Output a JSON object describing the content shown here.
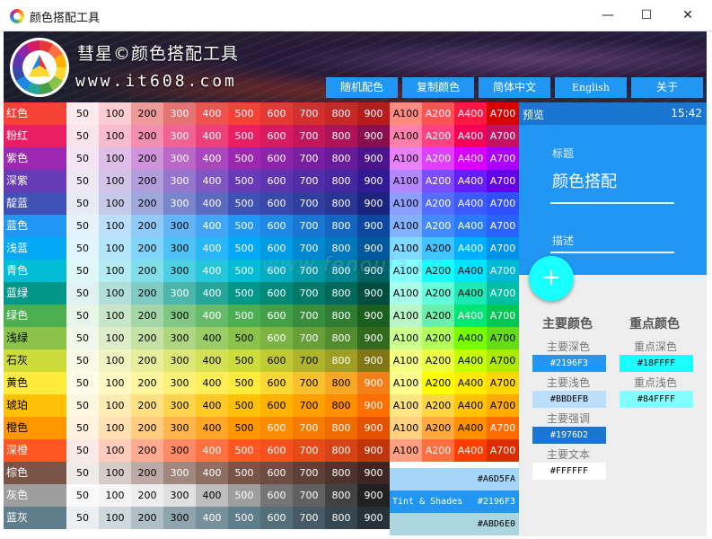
{
  "window": {
    "title": "颜色搭配工具"
  },
  "banner": {
    "brand": "彗星©颜色搭配工具",
    "site": "www.it608.com",
    "buttons": [
      "随机配色",
      "复制颜色",
      "简体中文",
      "English",
      "关于"
    ]
  },
  "grid": {
    "shade_labels": [
      "50",
      "100",
      "200",
      "300",
      "400",
      "500",
      "600",
      "700",
      "800",
      "900"
    ],
    "accent_labels": [
      "A100",
      "A200",
      "A400",
      "A700"
    ],
    "rows": [
      {
        "name": "红色",
        "shades": [
          "#ffebee",
          "#ffcdd2",
          "#ef9a9a",
          "#e57373",
          "#ef5350",
          "#f44336",
          "#e53935",
          "#d32f2f",
          "#c62828",
          "#b71c1c"
        ],
        "accents": [
          "#ff8a80",
          "#ff5252",
          "#ff1744",
          "#d50000"
        ]
      },
      {
        "name": "粉红",
        "shades": [
          "#fce4ec",
          "#f8bbd0",
          "#f48fb1",
          "#f06292",
          "#ec407a",
          "#e91e63",
          "#d81b60",
          "#c2185b",
          "#ad1457",
          "#880e4f"
        ],
        "accents": [
          "#ff80ab",
          "#ff4081",
          "#f50057",
          "#c51162"
        ]
      },
      {
        "name": "紫色",
        "shades": [
          "#f3e5f5",
          "#e1bee7",
          "#ce93d8",
          "#ba68c8",
          "#ab47bc",
          "#9c27b0",
          "#8e24aa",
          "#7b1fa2",
          "#6a1b9a",
          "#4a148c"
        ],
        "accents": [
          "#ea80fc",
          "#e040fb",
          "#d500f9",
          "#aa00ff"
        ]
      },
      {
        "name": "深紫",
        "shades": [
          "#ede7f6",
          "#d1c4e9",
          "#b39ddb",
          "#9575cd",
          "#7e57c2",
          "#673ab7",
          "#5e35b1",
          "#512da8",
          "#4527a0",
          "#311b92"
        ],
        "accents": [
          "#b388ff",
          "#7c4dff",
          "#651fff",
          "#6200ea"
        ]
      },
      {
        "name": "靛蓝",
        "shades": [
          "#e8eaf6",
          "#c5cae9",
          "#9fa8da",
          "#7986cb",
          "#5c6bc0",
          "#3f51b5",
          "#3949ab",
          "#303f9f",
          "#283593",
          "#1a237e"
        ],
        "accents": [
          "#8c9eff",
          "#536dfe",
          "#3d5afe",
          "#304ffe"
        ]
      },
      {
        "name": "蓝色",
        "shades": [
          "#e3f2fd",
          "#bbdefb",
          "#90caf9",
          "#64b5f6",
          "#42a5f5",
          "#2196f3",
          "#1e88e5",
          "#1976d2",
          "#1565c0",
          "#0d47a1"
        ],
        "accents": [
          "#82b1ff",
          "#448aff",
          "#2979ff",
          "#2962ff"
        ]
      },
      {
        "name": "浅蓝",
        "shades": [
          "#e1f5fe",
          "#b3e5fc",
          "#81d4fa",
          "#4fc3f7",
          "#29b6f6",
          "#03a9f4",
          "#039be5",
          "#0288d1",
          "#0277bd",
          "#01579b"
        ],
        "accents": [
          "#80d8ff",
          "#40c4ff",
          "#00b0ff",
          "#0091ea"
        ]
      },
      {
        "name": "青色",
        "shades": [
          "#e0f7fa",
          "#b2ebf2",
          "#80deea",
          "#4dd0e1",
          "#26c6da",
          "#00bcd4",
          "#00acc1",
          "#0097a7",
          "#00838f",
          "#006064"
        ],
        "accents": [
          "#84ffff",
          "#18ffff",
          "#00e5ff",
          "#00b8d4"
        ]
      },
      {
        "name": "蓝绿",
        "shades": [
          "#e0f2f1",
          "#b2dfdb",
          "#80cbc4",
          "#4db6ac",
          "#26a69a",
          "#009688",
          "#00897b",
          "#00796b",
          "#00695c",
          "#004d40"
        ],
        "accents": [
          "#a7ffeb",
          "#64ffda",
          "#1de9b6",
          "#00bfa5"
        ]
      },
      {
        "name": "绿色",
        "shades": [
          "#e8f5e9",
          "#c8e6c9",
          "#a5d6a7",
          "#81c784",
          "#66bb6a",
          "#4caf50",
          "#43a047",
          "#388e3c",
          "#2e7d32",
          "#1b5e20"
        ],
        "accents": [
          "#b9f6ca",
          "#69f0ae",
          "#00e676",
          "#00c853"
        ]
      },
      {
        "name": "浅绿",
        "shades": [
          "#f1f8e9",
          "#dcedc8",
          "#c5e1a5",
          "#aed581",
          "#9ccc65",
          "#8bc34a",
          "#7cb342",
          "#689f38",
          "#558b2f",
          "#33691e"
        ],
        "accents": [
          "#ccff90",
          "#b2ff59",
          "#76ff03",
          "#64dd17"
        ]
      },
      {
        "name": "石灰",
        "shades": [
          "#f9fbe7",
          "#f0f4c3",
          "#e6ee9c",
          "#dce775",
          "#d4e157",
          "#cddc39",
          "#c0ca33",
          "#afb42b",
          "#9e9d24",
          "#827717"
        ],
        "accents": [
          "#f4ff81",
          "#eeff41",
          "#c6ff00",
          "#aeea00"
        ]
      },
      {
        "name": "黄色",
        "shades": [
          "#fffde7",
          "#fff9c4",
          "#fff59d",
          "#fff176",
          "#ffee58",
          "#ffeb3b",
          "#fdd835",
          "#fbc02d",
          "#f9a825",
          "#f57f17"
        ],
        "accents": [
          "#ffff8d",
          "#ffff00",
          "#ffea00",
          "#ffd600"
        ]
      },
      {
        "name": "琥珀",
        "shades": [
          "#fff8e1",
          "#ffecb3",
          "#ffe082",
          "#ffd54f",
          "#ffca28",
          "#ffc107",
          "#ffb300",
          "#ffa000",
          "#ff8f00",
          "#ff6f00"
        ],
        "accents": [
          "#ffe57f",
          "#ffd740",
          "#ffc400",
          "#ffab00"
        ]
      },
      {
        "name": "橙色",
        "shades": [
          "#fff3e0",
          "#ffe0b2",
          "#ffcc80",
          "#ffb74d",
          "#ffa726",
          "#ff9800",
          "#fb8c00",
          "#f57c00",
          "#ef6c00",
          "#e65100"
        ],
        "accents": [
          "#ffd180",
          "#ffab40",
          "#ff9100",
          "#ff6d00"
        ]
      },
      {
        "name": "深橙",
        "shades": [
          "#fbe9e7",
          "#ffccbc",
          "#ffab91",
          "#ff8a65",
          "#ff7043",
          "#ff5722",
          "#f4511e",
          "#e64a19",
          "#d84315",
          "#bf360c"
        ],
        "accents": [
          "#ff9e80",
          "#ff6e40",
          "#ff3d00",
          "#dd2c00"
        ]
      },
      {
        "name": "棕色",
        "shades": [
          "#efebe9",
          "#d7ccc8",
          "#bcaaa4",
          "#a1887f",
          "#8d6e63",
          "#795548",
          "#6d4c41",
          "#5d4037",
          "#4e342e",
          "#3e2723"
        ],
        "accents": []
      },
      {
        "name": "灰色",
        "shades": [
          "#fafafa",
          "#f5f5f5",
          "#eeeeee",
          "#e0e0e0",
          "#bdbdbd",
          "#9e9e9e",
          "#757575",
          "#616161",
          "#424242",
          "#212121"
        ],
        "accents": []
      },
      {
        "name": "蓝灰",
        "shades": [
          "#eceff1",
          "#cfd8dc",
          "#b0bec5",
          "#90a4ae",
          "#78909c",
          "#607d8b",
          "#546e7a",
          "#455a64",
          "#37474f",
          "#263238"
        ],
        "accents": []
      }
    ],
    "tint_shades": {
      "label": "Tint & Shades",
      "values": [
        "#A6D5FA",
        "#2196F3",
        "#ABD6E0"
      ],
      "colors": [
        "#a6d5fa",
        "#2196f3",
        "#abd6e0"
      ]
    }
  },
  "preview": {
    "header": "预览",
    "clock": "15:42",
    "label": "标题",
    "title": "颜色搭配",
    "description": "描述",
    "fab": "+",
    "primary": {
      "heading": "主要颜色",
      "items": [
        {
          "label": "主要深色",
          "value": "#2196F3",
          "bg": "#2196f3",
          "fg": "#ffffff"
        },
        {
          "label": "主要浅色",
          "value": "#BBDEFB",
          "bg": "#bbdefb",
          "fg": "#000000"
        },
        {
          "label": "主要强调",
          "value": "#1976D2",
          "bg": "#1976d2",
          "fg": "#ffffff"
        },
        {
          "label": "主要文本",
          "value": "#FFFFFF",
          "bg": "#ffffff",
          "fg": "#000000"
        }
      ]
    },
    "accent": {
      "heading": "重点颜色",
      "items": [
        {
          "label": "重点深色",
          "value": "#18FFFF",
          "bg": "#18ffff",
          "fg": "#000000"
        },
        {
          "label": "重点浅色",
          "value": "#84FFFF",
          "bg": "#84ffff",
          "fg": "#000000"
        }
      ]
    }
  },
  "watermark": "www.fenoula.cn"
}
